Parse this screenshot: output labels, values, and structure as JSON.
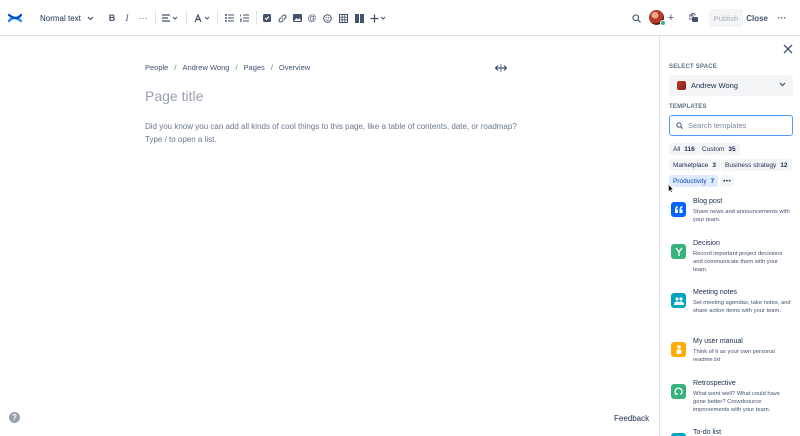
{
  "toolbar": {
    "text_style": "Normal text",
    "publish_label": "Publish",
    "close_label": "Close",
    "icons": [
      "confluence-logo",
      "bold",
      "italic",
      "more-formatting",
      "alignment",
      "text-color",
      "bullet-list",
      "numbered-list",
      "action-item",
      "link",
      "image",
      "mention",
      "emoji",
      "table",
      "layouts",
      "insert",
      "search",
      "invite",
      "restrictions",
      "more"
    ]
  },
  "editor": {
    "breadcrumb": [
      "People",
      "Andrew Wong",
      "Pages",
      "Overview"
    ],
    "title_placeholder": "Page title",
    "body_hint_line1": "Did you know you can add all kinds of cool things to this page, like a table of contents, date, or roadmap?",
    "body_hint_line2": "Type / to open a list.",
    "feedback_label": "Feedback"
  },
  "panel": {
    "select_space_label": "SELECT SPACE",
    "selected_space": "Andrew Wong",
    "templates_label": "TEMPLATES",
    "search_placeholder": "Search templates",
    "categories": [
      {
        "name": "All",
        "count": "116"
      },
      {
        "name": "Custom",
        "count": "35"
      },
      {
        "name": "Marketplace",
        "count": "3"
      },
      {
        "name": "Business strategy",
        "count": "12"
      },
      {
        "name": "Productivity",
        "count": "7"
      }
    ],
    "more_label": "•••",
    "templates": [
      {
        "title": "Blog post",
        "description": "Share news and announcements with your team.",
        "color": "#0065ff"
      },
      {
        "title": "Decision",
        "description": "Record important project decisions and communicate them with your team.",
        "color": "#36b37e"
      },
      {
        "title": "Meeting notes",
        "description": "Set meeting agendas, take notes, and share action items with your team.",
        "color": "#00a3bf"
      },
      {
        "title": "My user manual",
        "description": "Think of it as your own personal readme.txt",
        "color": "#ffab00"
      },
      {
        "title": "Retrospective",
        "description": "What went well? What could have gone better? Crowdsource improvements with your team.",
        "color": "#36b37e"
      },
      {
        "title": "To-do list",
        "description": "",
        "color": "#00a3bf"
      }
    ]
  }
}
